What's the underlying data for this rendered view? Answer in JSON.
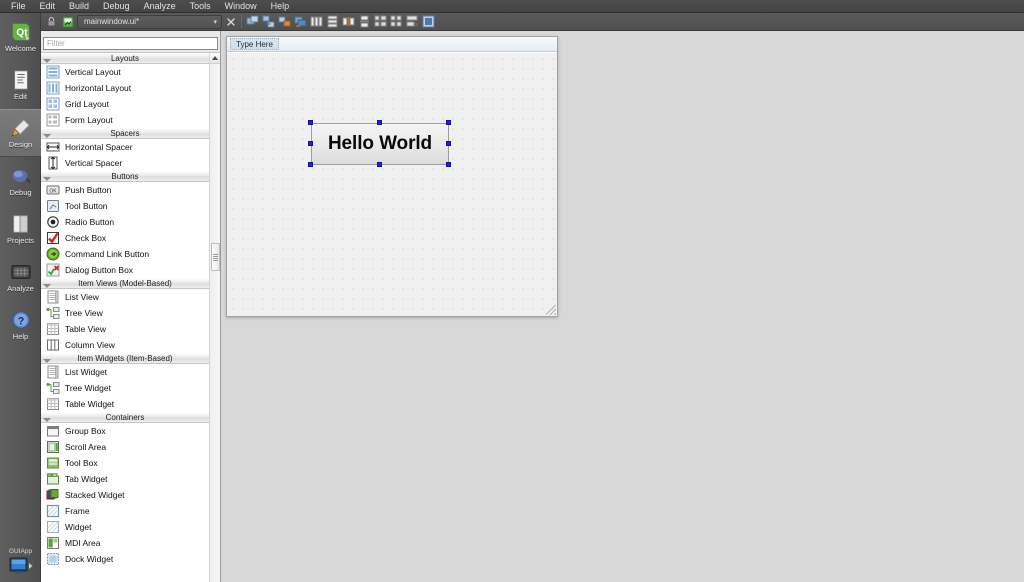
{
  "menubar": {
    "items": [
      {
        "label": "File"
      },
      {
        "label": "Edit"
      },
      {
        "label": "Build"
      },
      {
        "label": "Debug"
      },
      {
        "label": "Analyze"
      },
      {
        "label": "Tools"
      },
      {
        "label": "Window"
      },
      {
        "label": "Help"
      }
    ]
  },
  "mode_selector": {
    "items": [
      {
        "label": "Welcome",
        "icon": "qt-logo-icon",
        "selected": false
      },
      {
        "label": "Edit",
        "icon": "document-edit-icon",
        "selected": false
      },
      {
        "label": "Design",
        "icon": "paint-brush-icon",
        "selected": true
      },
      {
        "label": "Debug",
        "icon": "bug-icon",
        "selected": false
      },
      {
        "label": "Projects",
        "icon": "folder-projects-icon",
        "selected": false
      },
      {
        "label": "Analyze",
        "icon": "chart-analyze-icon",
        "selected": false
      },
      {
        "label": "Help",
        "icon": "question-mark-icon",
        "selected": false
      }
    ],
    "project_badge": {
      "label": "GUIApp",
      "icon": "monitor-run-icon"
    }
  },
  "designer_toolbar": {
    "lock_icon": "lock-icon",
    "file_icon": "ui-file-icon",
    "current_file": "mainwindow.ui*",
    "dropdown_caret": "chevron-down-icon",
    "close_icon": "close-icon",
    "buttons": [
      {
        "name": "edit-widgets-icon",
        "tooltip": "Edit Widgets"
      },
      {
        "name": "edit-signals-slots-icon",
        "tooltip": "Edit Signals/Slots"
      },
      {
        "name": "edit-buddies-icon",
        "tooltip": "Edit Buddies"
      },
      {
        "name": "edit-tab-order-icon",
        "tooltip": "Edit Tab Order"
      },
      {
        "name": "layout-horizontally-icon",
        "tooltip": "Lay Out Horizontally"
      },
      {
        "name": "layout-vertically-icon",
        "tooltip": "Lay Out Vertically"
      },
      {
        "name": "layout-splitter-horizontal-icon",
        "tooltip": "Lay Out Horizontally in Splitter"
      },
      {
        "name": "layout-splitter-vertical-icon",
        "tooltip": "Lay Out Vertically in Splitter"
      },
      {
        "name": "layout-form-icon",
        "tooltip": "Lay Out in a Form Layout"
      },
      {
        "name": "layout-grid-icon",
        "tooltip": "Lay Out in a Grid"
      },
      {
        "name": "break-layout-icon",
        "tooltip": "Break Layout"
      },
      {
        "name": "adjust-size-icon",
        "tooltip": "Adjust Size"
      }
    ]
  },
  "widget_box": {
    "filter_placeholder": "Filter",
    "filter_value": "",
    "scrollbar": {
      "up_arrow": "scroll-up-arrow-icon"
    },
    "groups": [
      {
        "title": "Layouts",
        "items": [
          {
            "label": "Vertical Layout",
            "icon": "vertical-layout-icon"
          },
          {
            "label": "Horizontal Layout",
            "icon": "horizontal-layout-icon"
          },
          {
            "label": "Grid Layout",
            "icon": "grid-layout-icon"
          },
          {
            "label": "Form Layout",
            "icon": "form-layout-icon"
          }
        ]
      },
      {
        "title": "Spacers",
        "items": [
          {
            "label": "Horizontal Spacer",
            "icon": "horizontal-spacer-icon"
          },
          {
            "label": "Vertical Spacer",
            "icon": "vertical-spacer-icon"
          }
        ]
      },
      {
        "title": "Buttons",
        "items": [
          {
            "label": "Push Button",
            "icon": "push-button-icon"
          },
          {
            "label": "Tool Button",
            "icon": "tool-button-icon"
          },
          {
            "label": "Radio Button",
            "icon": "radio-button-icon"
          },
          {
            "label": "Check Box",
            "icon": "check-box-icon"
          },
          {
            "label": "Command Link Button",
            "icon": "command-link-button-icon"
          },
          {
            "label": "Dialog Button Box",
            "icon": "dialog-button-box-icon"
          }
        ]
      },
      {
        "title": "Item Views (Model-Based)",
        "items": [
          {
            "label": "List View",
            "icon": "list-view-icon"
          },
          {
            "label": "Tree View",
            "icon": "tree-view-icon"
          },
          {
            "label": "Table View",
            "icon": "table-view-icon"
          },
          {
            "label": "Column View",
            "icon": "column-view-icon"
          }
        ]
      },
      {
        "title": "Item Widgets (Item-Based)",
        "items": [
          {
            "label": "List Widget",
            "icon": "list-widget-icon"
          },
          {
            "label": "Tree Widget",
            "icon": "tree-widget-icon"
          },
          {
            "label": "Table Widget",
            "icon": "table-widget-icon"
          }
        ]
      },
      {
        "title": "Containers",
        "items": [
          {
            "label": "Group Box",
            "icon": "group-box-icon"
          },
          {
            "label": "Scroll Area",
            "icon": "scroll-area-icon"
          },
          {
            "label": "Tool Box",
            "icon": "tool-box-icon"
          },
          {
            "label": "Tab Widget",
            "icon": "tab-widget-icon"
          },
          {
            "label": "Stacked Widget",
            "icon": "stacked-widget-icon"
          },
          {
            "label": "Frame",
            "icon": "frame-icon"
          },
          {
            "label": "Widget",
            "icon": "widget-icon"
          },
          {
            "label": "MDI Area",
            "icon": "mdi-area-icon"
          },
          {
            "label": "Dock Widget",
            "icon": "dock-widget-icon"
          }
        ]
      }
    ]
  },
  "form_editor": {
    "menubar_placeholder": "Type Here",
    "selected_widget": {
      "text": "Hello World",
      "handle_color": "#2424c8",
      "handles": 8
    }
  }
}
